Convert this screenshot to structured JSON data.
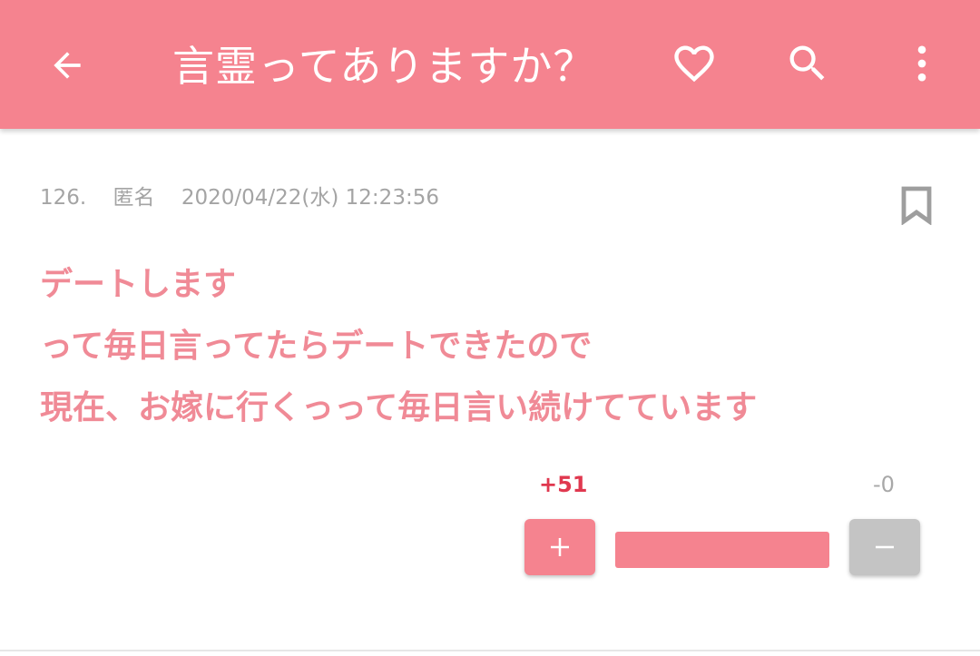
{
  "header": {
    "title": "言霊ってありますか？",
    "icons": [
      "arrow-back-icon",
      "heart-outline-icon",
      "search-icon",
      "more-vert-icon"
    ],
    "color": "#f5838f"
  },
  "comment": {
    "number": "126.",
    "author": "匿名",
    "datetime": "2020/04/22(水) 12:23:56",
    "lines": [
      "デートします",
      "って毎日言ってたらデートできたので",
      "現在、お嫁に行くっって毎日言い続けてています"
    ],
    "text_color": "#f08a96",
    "votes": {
      "plus_label": "+51",
      "minus_label": "-0",
      "plus_symbol": "+",
      "minus_symbol": "−",
      "plus_ratio": 1.0
    }
  }
}
